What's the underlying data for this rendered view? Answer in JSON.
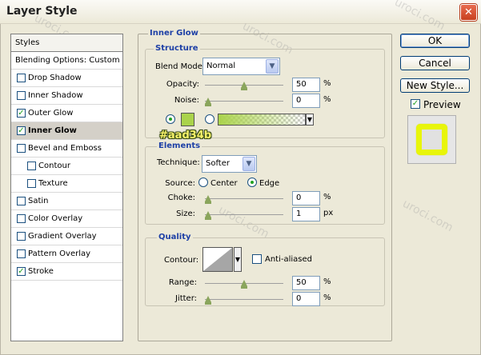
{
  "window": {
    "title": "Layer Style",
    "close_symbol": "✕"
  },
  "styles_panel": {
    "header": "Styles",
    "blending": "Blending Options: Custom",
    "items": [
      {
        "label": "Drop Shadow",
        "checked": false
      },
      {
        "label": "Inner Shadow",
        "checked": false
      },
      {
        "label": "Outer Glow",
        "checked": true
      },
      {
        "label": "Inner Glow",
        "checked": true,
        "selected": true
      },
      {
        "label": "Bevel and Emboss",
        "checked": false
      },
      {
        "label": "Contour",
        "checked": false,
        "indent": true
      },
      {
        "label": "Texture",
        "checked": false,
        "indent": true
      },
      {
        "label": "Satin",
        "checked": false
      },
      {
        "label": "Color Overlay",
        "checked": false
      },
      {
        "label": "Gradient Overlay",
        "checked": false
      },
      {
        "label": "Pattern Overlay",
        "checked": false
      },
      {
        "label": "Stroke",
        "checked": true
      }
    ]
  },
  "inner_glow": {
    "title": "Inner Glow",
    "structure": {
      "title": "Structure",
      "blend_mode_label": "Blend Mode:",
      "blend_mode": "Normal",
      "opacity_label": "Opacity:",
      "opacity": "50",
      "opacity_unit": "%",
      "opacity_level": 50,
      "noise_label": "Noise:",
      "noise": "0",
      "noise_unit": "%",
      "noise_level": 0,
      "glow_color": "#aad34b",
      "color_annotation": "#aad34b"
    },
    "elements": {
      "title": "Elements",
      "technique_label": "Technique:",
      "technique": "Softer",
      "source_label": "Source:",
      "source_center": "Center",
      "source_edge": "Edge",
      "source_selected": "Edge",
      "choke_label": "Choke:",
      "choke": "0",
      "choke_unit": "%",
      "choke_level": 0,
      "size_label": "Size:",
      "size": "1",
      "size_unit": "px",
      "size_level": 0
    },
    "quality": {
      "title": "Quality",
      "contour_label": "Contour:",
      "anti_aliased_label": "Anti-aliased",
      "anti_aliased": false,
      "range_label": "Range:",
      "range": "50",
      "range_unit": "%",
      "range_level": 50,
      "jitter_label": "Jitter:",
      "jitter": "0",
      "jitter_unit": "%",
      "jitter_level": 0
    }
  },
  "buttons": {
    "ok": "OK",
    "cancel": "Cancel",
    "new_style": "New Style...",
    "preview_label": "Preview",
    "preview_checked": true
  },
  "preview_color": "#e8f50a",
  "watermarks": [
    "uroci.com",
    "uroci.com",
    "uroci.com",
    "uroci.com",
    "uroci.com"
  ]
}
